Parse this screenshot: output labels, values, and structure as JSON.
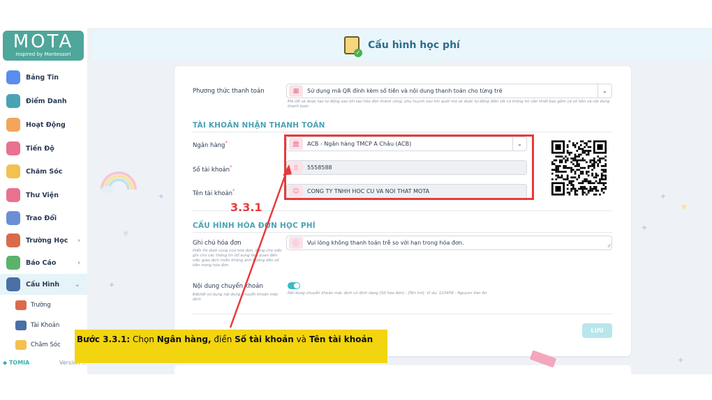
{
  "sidebar": {
    "logo_text": "MOTA",
    "logo_tagline": "Inspired by Montessori",
    "items": [
      {
        "label": "Bảng Tin",
        "icon": "globe-icon",
        "color": "#5b8def"
      },
      {
        "label": "Điểm Danh",
        "icon": "clock-icon",
        "color": "#4aa3b5"
      },
      {
        "label": "Hoạt Động",
        "icon": "activity-icon",
        "color": "#f2a65a"
      },
      {
        "label": "Tiến Độ",
        "icon": "chart-book-icon",
        "color": "#e8728f"
      },
      {
        "label": "Chăm Sóc",
        "icon": "care-icon",
        "color": "#f2c14e"
      },
      {
        "label": "Thư Viện",
        "icon": "library-icon",
        "color": "#e8728f"
      },
      {
        "label": "Trao Đổi",
        "icon": "chat-icon",
        "color": "#6b8fd6"
      },
      {
        "label": "Trường Học",
        "icon": "school-icon",
        "color": "#d96b4a"
      },
      {
        "label": "Báo Cáo",
        "icon": "report-icon",
        "color": "#5bb36b"
      },
      {
        "label": "Cấu Hình",
        "icon": "settings-icon",
        "color": "#4a6fa5"
      }
    ],
    "sub_items": [
      {
        "label": "Trường",
        "icon": "school-icon",
        "color": "#d96b4a"
      },
      {
        "label": "Tài Khoản",
        "icon": "account-icon",
        "color": "#4a6fa5"
      },
      {
        "label": "Chăm Sóc",
        "icon": "care-icon",
        "color": "#f2c14e"
      }
    ],
    "footer_brand": "TOMIA",
    "footer_version": "Version ...",
    "chevron": "›",
    "chevron_down": "⌄"
  },
  "header": {
    "title": "Cấu hình học phí"
  },
  "form": {
    "payment_method_label": "Phương thức thanh toán",
    "payment_method_value": "Sử dụng mã QR đính kèm số tiền và nội dung thanh toán cho từng trẻ",
    "payment_method_hint": "Mã QR sẽ được tạo tự động sau khi tạo hóa đơn thành công, phụ huynh sau khi quét mã sẽ được tự động điền tất cả thông tin cần thiết bao gồm cả số tiền và nội dung thanh toán",
    "section_account": "TÀI KHOẢN NHẬN THANH TOÁN",
    "bank_label": "Ngân hàng",
    "bank_value": "ACB - Ngân hàng TMCP Á Châu (ACB)",
    "account_number_label": "Số tài khoản",
    "account_number_value": "5558588",
    "account_name_label": "Tên tài khoản",
    "account_name_value": "CONG TY TNHH HOC CU VA NOI THAT MOTA",
    "required_mark": "*",
    "section_invoice": "CẤU HÌNH HÓA ĐƠN HỌC PHÍ",
    "invoice_note_label": "Ghi chú hóa đơn",
    "invoice_note_hint": "Hiển thị dưới cùng của hóa đơn, dùng cho việc ghi chú các thông tin bổ sung liên quan đến việc giao dịch miễn không ảnh hưởng đến số tiền trong hóa đơn",
    "invoice_note_value": "Vui lòng không thanh toán trễ so với hạn trong hóa đơn.",
    "transfer_content_label": "Nội dung chuyển khoản",
    "transfer_content_hint": "Bật/tắt sử dụng nội dung chuyển khoản mặc định",
    "transfer_content_desc": "Nội dung chuyển khoản mặc định có định dạng [Số hóa đơn] - [Tên trẻ]. Ví dụ: 123456 - Nguyen Van An",
    "transfer_toggle_on": true,
    "save_label": "LƯU"
  },
  "annotation": {
    "step_number": "3.3.1",
    "caption_prefix": "Bước 3.3.1:",
    "caption_t1": " Chọn ",
    "caption_b1": "Ngân hàng,",
    "caption_t2": " điền ",
    "caption_b2": "Số tài khoản",
    "caption_t3": " và ",
    "caption_b3": "Tên tài khoản",
    "highlight_color": "#e83a3a",
    "caption_bg": "#f2d40f"
  }
}
